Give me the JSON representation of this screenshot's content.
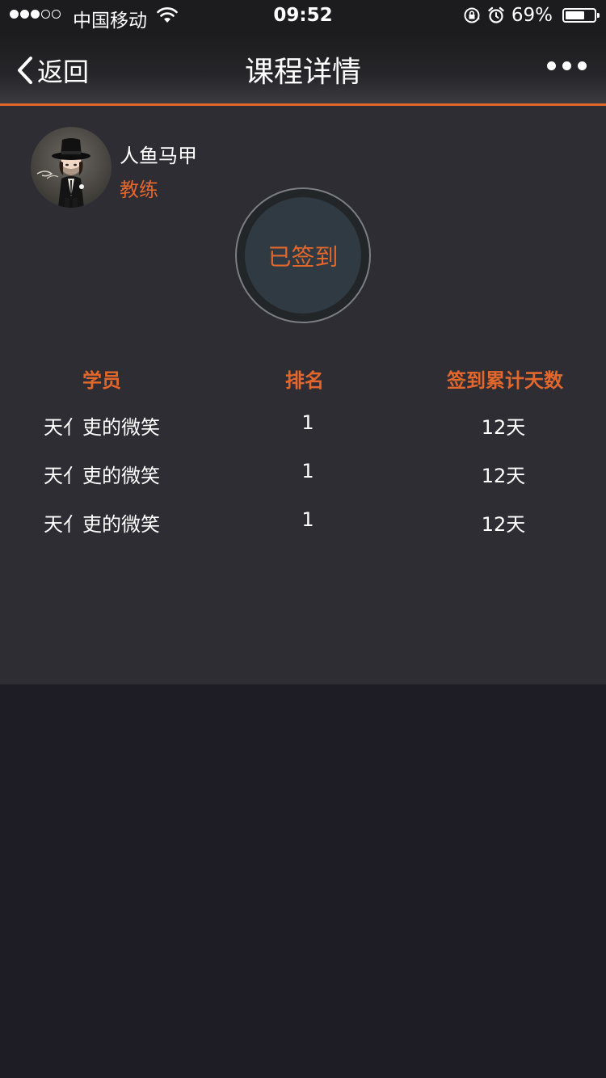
{
  "status_bar": {
    "signal_dots": [
      true,
      true,
      true,
      false,
      false
    ],
    "carrier": "中国移动",
    "wifi_icon": "wifi-icon",
    "time": "09:52",
    "lock_icon": "orientation-lock-icon",
    "alarm_icon": "alarm-icon",
    "battery_percent": "69%",
    "battery_level": 0.69
  },
  "nav": {
    "back_label": "返回",
    "title": "课程详情",
    "more_icon": "more-dots-icon"
  },
  "coach": {
    "name": "人鱼马甲",
    "role": "教练",
    "avatar_icon": "cartoon-avatar"
  },
  "checkin": {
    "label": "已签到"
  },
  "table": {
    "headers": [
      "学员",
      "排名",
      "签到累计天数"
    ],
    "rows": [
      [
        "天亻吏的微笑",
        "1",
        "12天"
      ],
      [
        "天亻吏的微笑",
        "1",
        "12天"
      ],
      [
        "天亻吏的微笑",
        "1",
        "12天"
      ]
    ]
  },
  "colors": {
    "accent": "#e2672c",
    "panel_bg": "#2e2d34",
    "page_bg": "#1e1d26",
    "button_inner": "#303a43"
  }
}
